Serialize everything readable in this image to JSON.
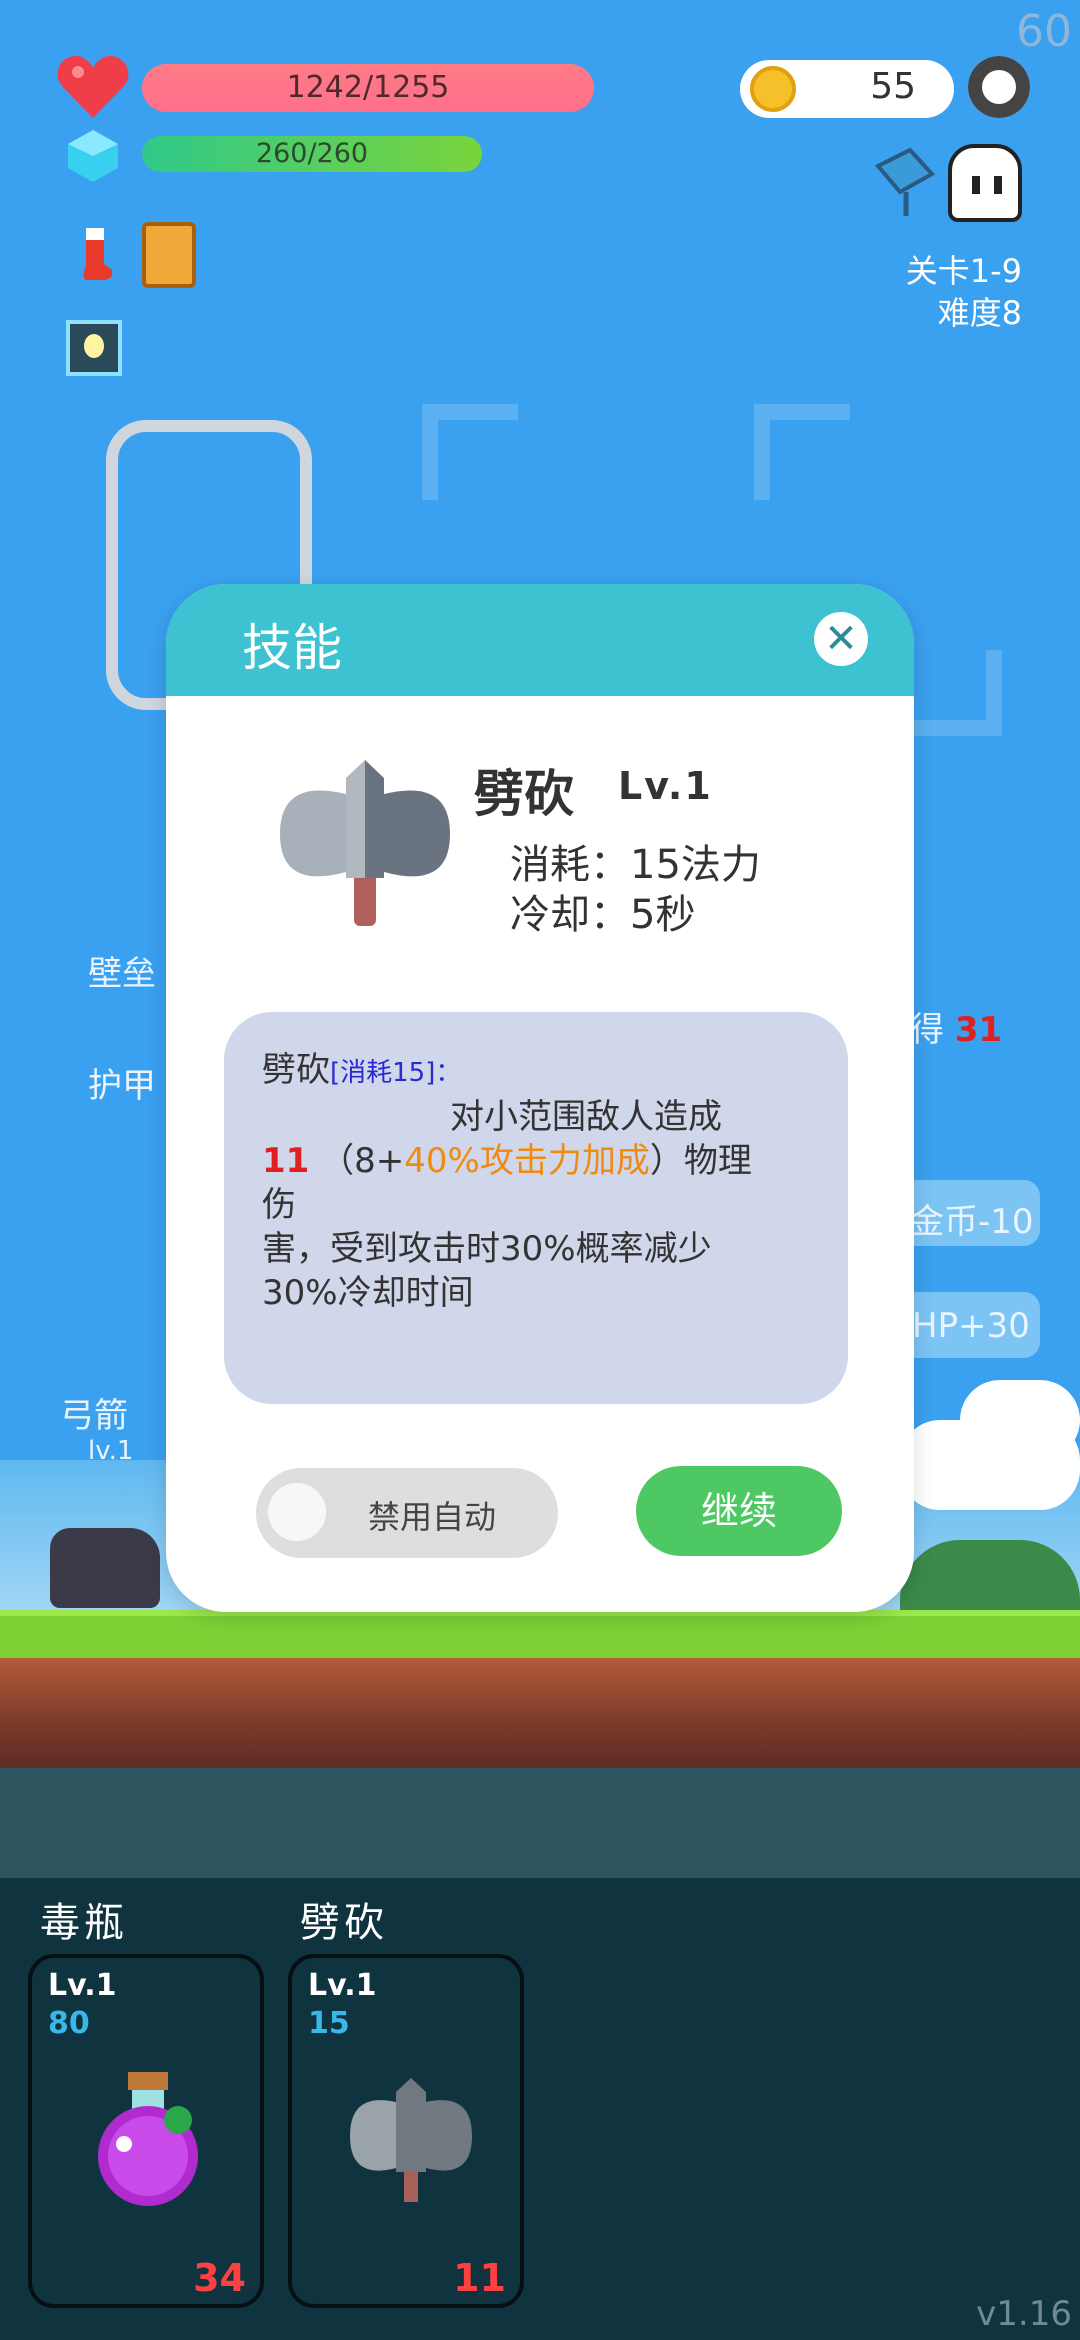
{
  "hud": {
    "fps": "60",
    "hp": "1242/1255",
    "hp_fraction": 0.99,
    "mp": "260/260",
    "mp_fraction": 1.0,
    "coins": "55",
    "stage": "关卡1-9",
    "difficulty": "难度8",
    "icons": [
      "heart-icon",
      "crystal-icon",
      "sock-icon",
      "book-icon",
      "lightbulb-icon",
      "gear-icon",
      "flag-icon",
      "ghost-icon"
    ]
  },
  "background_labels": {
    "wall": "壁垒",
    "armor": "护甲",
    "gain": "得",
    "gain_value": "31",
    "coins_minus": "金币-10",
    "hp_plus": "HP+30",
    "archer": "弓箭",
    "archer_lv": "lv.1"
  },
  "modal": {
    "title": "技能",
    "close": "✕",
    "skill_name": "劈砍",
    "skill_level": "Lv.1",
    "cost": "消耗：15法力",
    "cooldown": "冷却：5秒",
    "desc_name": "劈砍",
    "desc_tag": "[消耗15]：",
    "desc_line1": "对小范围敌人造成",
    "desc_damage": "11",
    "desc_formula_open": "（8+",
    "desc_bonus": "40%攻击力加成",
    "desc_formula_close": "）物理伤",
    "desc_rest": "害，受到攻击时30%概率减少30%冷却时间",
    "auto_toggle_label": "禁用自动",
    "continue_label": "继续"
  },
  "skills": [
    {
      "name": "毒瓶",
      "level": "Lv.1",
      "cost": "80",
      "damage": "34",
      "icon": "potion-icon"
    },
    {
      "name": "劈砍",
      "level": "Lv.1",
      "cost": "15",
      "damage": "11",
      "icon": "axe-icon"
    }
  ],
  "version": "v1.16",
  "colors": {
    "accent": "#3cc2d0",
    "continue": "#4ec863",
    "damage": "#e02020",
    "bonus": "#f08a10"
  }
}
